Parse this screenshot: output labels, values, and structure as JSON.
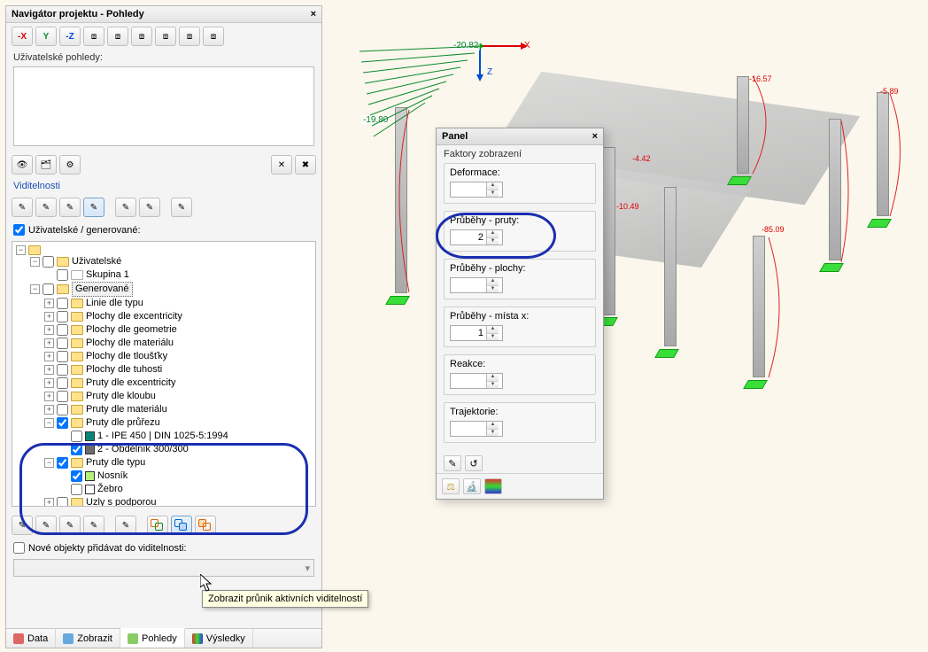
{
  "navigator": {
    "title": "Navigátor projektu - Pohledy",
    "userViewsLabel": "Uživatelské pohledy:",
    "visibilitiesLabel": "Viditelnosti",
    "userGenerated": {
      "checked": true,
      "label": "Uživatelské / generované:"
    },
    "tree": {
      "root": "",
      "userFolder": "Uživatelské",
      "group1": "Skupina 1",
      "generated": "Generované",
      "items": [
        "Linie dle typu",
        "Plochy dle excentricity",
        "Plochy dle geometrie",
        "Plochy dle materiálu",
        "Plochy dle tloušťky",
        "Plochy dle tuhosti",
        "Pruty dle excentricity",
        "Pruty dle kloubu",
        "Pruty dle materiálu"
      ],
      "prutyPrurezu": "Pruty dle průřezu",
      "ipe": "1 - IPE 450 | DIN 1025-5:1994",
      "rect": "2 - Obdélník 300/300",
      "prutyTypu": "Pruty dle typu",
      "nosnik": "Nosník",
      "zebro": "Žebro",
      "uzly": "Uzly s podporou"
    },
    "addNewLabel": "Nové objekty přidávat do viditelnosti:",
    "tabs": {
      "data": "Data",
      "zobrazit": "Zobrazit",
      "pohledy": "Pohledy",
      "vysledky": "Výsledky"
    },
    "tooltip": "Zobrazit průnik aktivních viditelností"
  },
  "panel": {
    "title": "Panel",
    "factorsLabel": "Faktory zobrazení",
    "deformace": {
      "label": "Deformace:",
      "value": ""
    },
    "prubehyPruty": {
      "label": "Průběhy - pruty:",
      "value": "2"
    },
    "prubehyPlochy": {
      "label": "Průběhy - plochy:",
      "value": ""
    },
    "prubehyMista": {
      "label": "Průběhy - místa x:",
      "value": "1"
    },
    "reakce": {
      "label": "Reakce:",
      "value": ""
    },
    "trajektorie": {
      "label": "Trajektorie:",
      "value": ""
    }
  },
  "viewport": {
    "loadLabels": [
      "-20.82",
      "-19.80"
    ],
    "redLabels": [
      "-16.57",
      "-4.42",
      "-10.49",
      "-85.09",
      "-5.89"
    ],
    "axes": {
      "x": "X",
      "z": "Z"
    }
  }
}
